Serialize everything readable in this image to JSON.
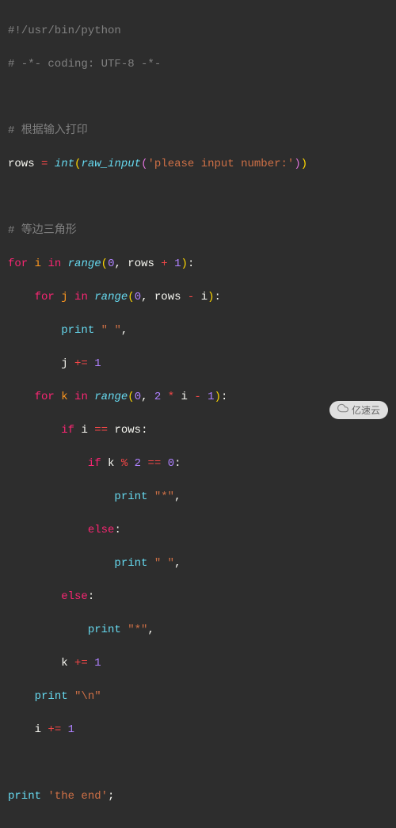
{
  "code": {
    "l1_shebang": "#!/usr/bin/python",
    "l2_coding": "# -*- coding: UTF-8 -*-",
    "l4_comment": "# 根据输入打印",
    "l5_rows": "rows",
    "l5_eq": " = ",
    "l5_int": "int",
    "l5_rawinput": "raw_input",
    "l5_prompt": "'please input number:'",
    "l7_comment": "# 等边三角形",
    "kw_for": "for",
    "kw_in": "in",
    "kw_if": "if",
    "kw_else": "else",
    "kw_print": "print",
    "var_i": "i",
    "var_j": "j",
    "var_k": "k",
    "var_rows": "rows",
    "fn_range": "range",
    "num_0": "0",
    "num_1": "1",
    "num_2": "2",
    "op_plus": " + ",
    "op_minus": " - ",
    "op_mul": " * ",
    "op_eqeq": " == ",
    "op_mod": " % ",
    "op_pluseq": " += ",
    "str_space": "\" \"",
    "str_star": "\"*\"",
    "str_nl": "\"\\n\"",
    "str_end": "'the end'",
    "colon": ":",
    "comma": ", ",
    "semicolon": ";"
  },
  "watermark": {
    "text": "亿速云"
  }
}
